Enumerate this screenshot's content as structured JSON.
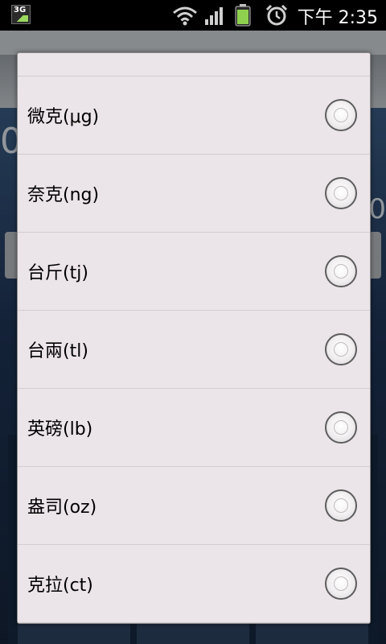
{
  "status_bar": {
    "network_type": "3G",
    "time": "下午 2:35",
    "icons": [
      "network-3g-icon",
      "wifi-icon",
      "signal-icon",
      "battery-icon",
      "alarm-icon"
    ]
  },
  "colors": {
    "dialog_bg": "#ebe4e8",
    "divider": "#d3cdd1",
    "battery_green": "#8fd14f",
    "app_bg": "#1b2c44"
  },
  "units": [
    {
      "label": "微克(μg)",
      "selected": false
    },
    {
      "label": "奈克(ng)",
      "selected": false
    },
    {
      "label": "台斤(tj)",
      "selected": false
    },
    {
      "label": "台兩(tl)",
      "selected": false
    },
    {
      "label": "英磅(lb)",
      "selected": false
    },
    {
      "label": "盎司(oz)",
      "selected": false
    },
    {
      "label": "克拉(ct)",
      "selected": false
    }
  ]
}
